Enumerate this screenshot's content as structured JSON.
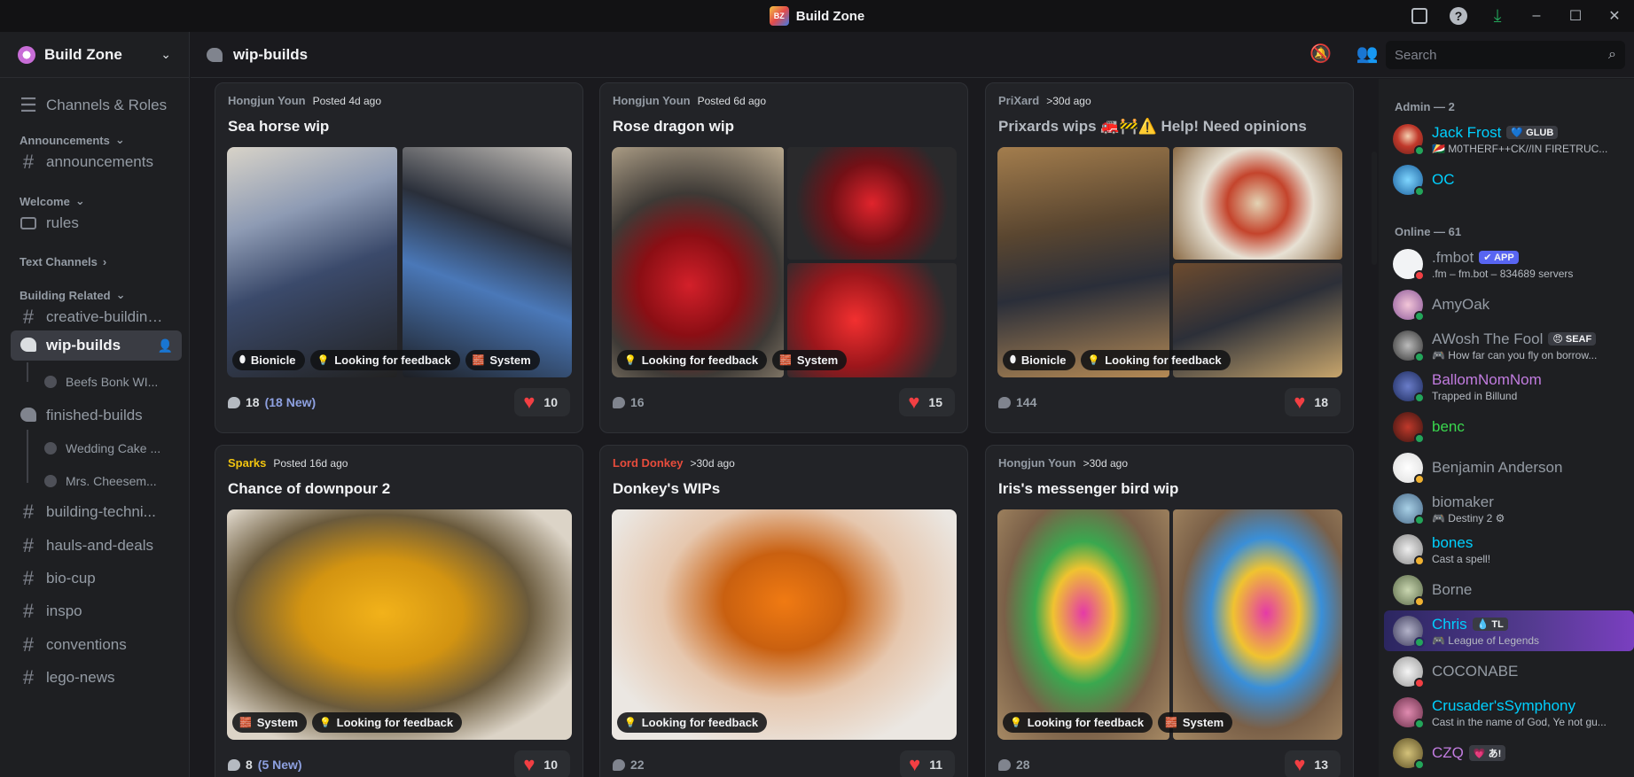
{
  "window": {
    "title": "Build Zone",
    "logo_text": "BZ"
  },
  "server": {
    "name": "Build Zone"
  },
  "sidebar": {
    "channels_roles": "Channels & Roles",
    "cat_announcements": "Announcements",
    "announcements": "announcements",
    "cat_welcome": "Welcome",
    "rules": "rules",
    "cat_text": "Text Channels",
    "cat_building": "Building Related",
    "creative": "creative-building-...",
    "wip": "wip-builds",
    "thread_wip_1": "Beefs Bonk WI...",
    "finished": "finished-builds",
    "thread_fin_1": "Wedding Cake ...",
    "thread_fin_2": "Mrs. Cheesem...",
    "techniques": "building-techni...",
    "hauls": "hauls-and-deals",
    "biocup": "bio-cup",
    "inspo": "inspo",
    "conventions": "conventions",
    "legonews": "lego-news"
  },
  "header": {
    "channel": "wip-builds",
    "search_placeholder": "Search"
  },
  "posts": [
    {
      "author": "Hongjun Youn",
      "author_color": "#949ba4",
      "posted": "Posted 4d ago",
      "title": "Sea horse wip",
      "tags": [
        "Bionicle",
        "Looking for feedback",
        "System"
      ],
      "comments": "18",
      "new": "(18 New)",
      "likes": "10"
    },
    {
      "author": "Hongjun Youn",
      "author_color": "#949ba4",
      "posted": "Posted 6d ago",
      "title": "Rose dragon wip",
      "tags": [
        "Looking for feedback",
        "System"
      ],
      "comments": "16",
      "new": "",
      "likes": "15"
    },
    {
      "author": "PriXard",
      "author_color": "#949ba4",
      "posted": ">30d ago",
      "title": "Prixards wips 🚒🚧⚠️ Help! Need opinions",
      "tags": [
        "Bionicle",
        "Looking for feedback"
      ],
      "comments": "144",
      "new": "",
      "likes": "18"
    },
    {
      "author": "Sparks",
      "author_color": "#f1c40f",
      "posted": "Posted 16d ago",
      "title": "Chance of downpour 2",
      "tags": [
        "System",
        "Looking for feedback"
      ],
      "comments": "8",
      "new": "(5 New)",
      "likes": "10"
    },
    {
      "author": "Lord Donkey",
      "author_color": "#e74c3c",
      "posted": ">30d ago",
      "title": "Donkey's WIPs",
      "tags": [
        "Looking for feedback"
      ],
      "comments": "22",
      "new": "",
      "likes": "11"
    },
    {
      "author": "Hongjun Youn",
      "author_color": "#949ba4",
      "posted": ">30d ago",
      "title": "Iris's messenger bird wip",
      "tags": [
        "Looking for feedback",
        "System"
      ],
      "comments": "28",
      "new": "",
      "likes": "13"
    }
  ],
  "members": {
    "admin_header": "Admin — 2",
    "online_header": "Online — 61",
    "list": [
      {
        "name": "Jack Frost",
        "color": "#00d0ff",
        "badge": "💙 GLUB",
        "sub": "🇸🇨 M0THERF++CK//IN FIRETRUC...",
        "status": "#23a55a"
      },
      {
        "name": "OC",
        "color": "#00d0ff",
        "badge": "",
        "sub": "",
        "status": "#23a55a"
      },
      {
        "name": ".fmbot",
        "color": "#949ba4",
        "badge": "✔ APP",
        "sub": ".fm – fm.bot – 834689 servers",
        "status": "#f23f43"
      },
      {
        "name": "AmyOak",
        "color": "#949ba4",
        "badge": "",
        "sub": "",
        "status": "#23a55a"
      },
      {
        "name": "AWosh The Fool",
        "color": "#949ba4",
        "badge": "😠 SEAF",
        "sub": "🎮 How far can you fly on borrow...",
        "status": "#23a55a"
      },
      {
        "name": "BallomNomNom",
        "color": "#c27ce0",
        "badge": "",
        "sub": "Trapped in Billund",
        "status": "#23a55a"
      },
      {
        "name": "benc",
        "color": "#3ad84e",
        "badge": "",
        "sub": "",
        "status": "#23a55a"
      },
      {
        "name": "Benjamin Anderson",
        "color": "#949ba4",
        "badge": "",
        "sub": "",
        "status": "#f0b232"
      },
      {
        "name": "biomaker",
        "color": "#949ba4",
        "badge": "",
        "sub": "🎮 Destiny 2 ⚙",
        "status": "#23a55a"
      },
      {
        "name": "bones",
        "color": "#00d0ff",
        "badge": "",
        "sub": "Cast a spell!",
        "status": "#f0b232"
      },
      {
        "name": "Borne",
        "color": "#949ba4",
        "badge": "",
        "sub": "",
        "status": "#f0b232"
      },
      {
        "name": "Chris",
        "color": "#00d0ff",
        "badge": "💧 TL",
        "sub": "🎮 League of Legends",
        "status": "#23a55a"
      },
      {
        "name": "COCONABE",
        "color": "#949ba4",
        "badge": "",
        "sub": "",
        "status": "#f23f43"
      },
      {
        "name": "Crusader'sSymphony",
        "color": "#00d0ff",
        "badge": "",
        "sub": "Cast in the name of God, Ye not gu...",
        "status": "#23a55a"
      },
      {
        "name": "CZQ",
        "color": "#c27ce0",
        "badge": "💗 あ!",
        "sub": "",
        "status": "#23a55a"
      }
    ]
  }
}
